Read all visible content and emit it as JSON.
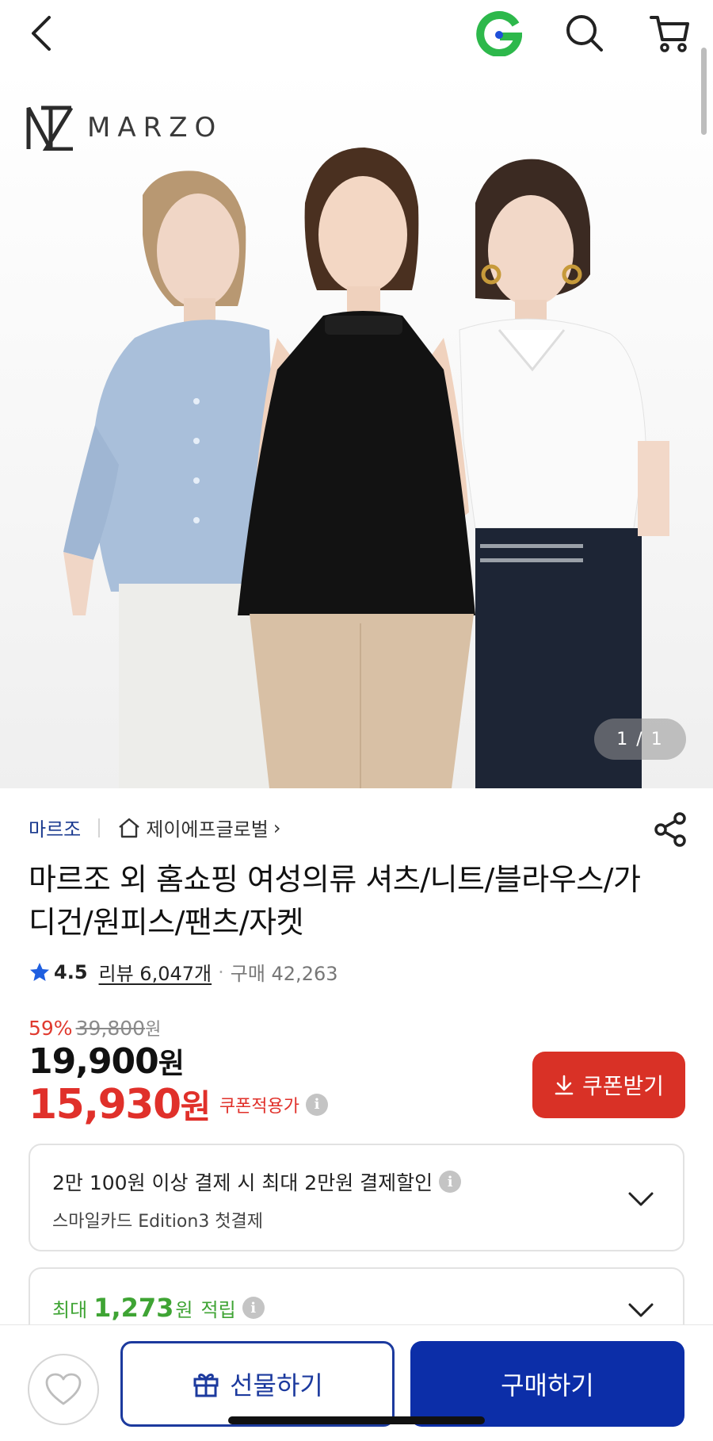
{
  "topbar": {
    "back_icon": "chevron-left-icon",
    "brand_icon": "g-logo-icon",
    "search_icon": "search-icon",
    "cart_icon": "cart-icon"
  },
  "hero": {
    "logo_text": "MARZO",
    "counter": "1 / 1",
    "image_description_icon": "product-photo"
  },
  "product": {
    "brand": "마르조",
    "store": "제이에프글로벌",
    "store_chevron": "›",
    "title": "마르조 외 홈쇼핑 여성의류 셔츠/니트/블라우스/가디건/원피스/팬츠/자켓",
    "rating": "4.5",
    "review_label": "리뷰 6,047개",
    "sales_dot": "·",
    "sales": "구매 42,263",
    "discount_pct": "59%",
    "original_price": "39,800",
    "original_unit": "원",
    "price": "19,900",
    "price_unit": "원",
    "coupon_price": "15,930",
    "coupon_unit": "원",
    "coupon_label": "쿠폰적용가",
    "info_glyph": "i",
    "coupon_button": "쿠폰받기"
  },
  "offers": {
    "card_discount_title": "2만 100원 이상 결제 시 최대 2만원 결제할인",
    "card_discount_sub": "스마일카드 Edition3 첫결제",
    "points_prefix": "최대",
    "points_amount": "1,273",
    "points_unit": "원",
    "points_suffix": "적립"
  },
  "bottom": {
    "gift_label": "선물하기",
    "buy_label": "구매하기"
  },
  "colors": {
    "accent_red": "#d93126",
    "accent_blue": "#0c2ea8",
    "points_green": "#3fa434",
    "brand_navy": "#1a3a8f"
  }
}
